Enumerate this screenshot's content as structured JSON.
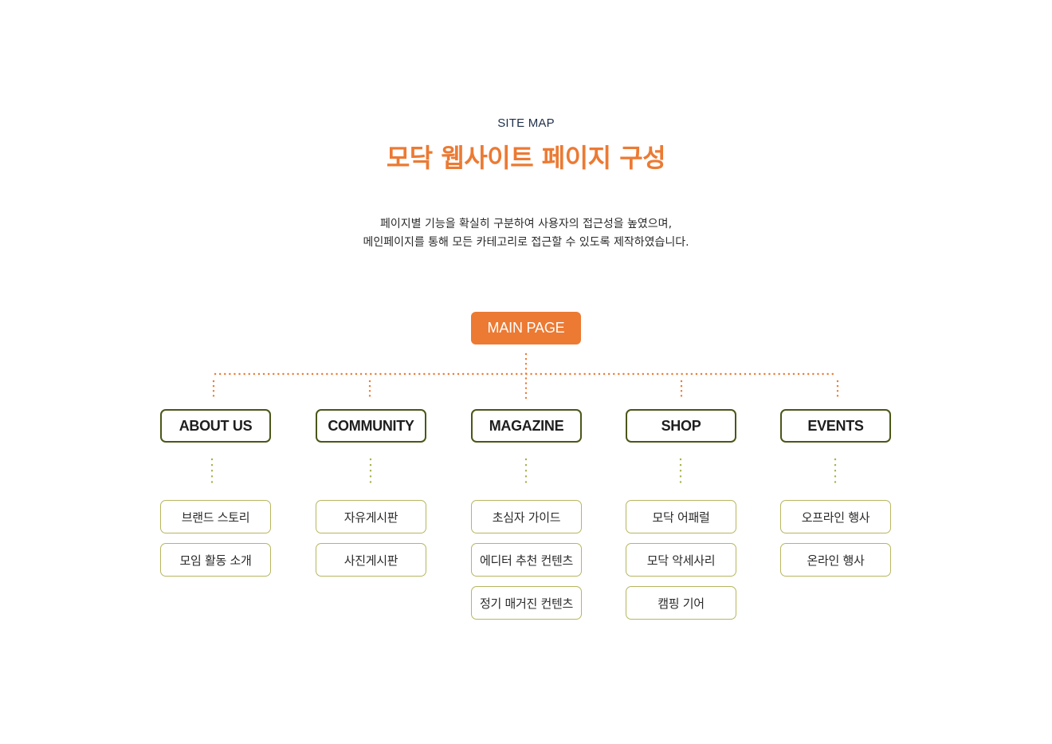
{
  "header": {
    "eyebrow": "SITE MAP",
    "title": "모닥 웹사이트 페이지 구성",
    "description_lines": [
      "페이지별 기능을 확실히 구분하여 사용자의 접근성을 높였으며,",
      "메인페이지를 통해 모든 카테고리로 접근할 수 있도록 제작하였습니다."
    ]
  },
  "colors": {
    "accent": "#ec7a33",
    "category_border": "#4a5719",
    "subpage_border": "#b7b65e",
    "sub_connector": "#a8b04a"
  },
  "sitemap": {
    "root": "MAIN PAGE",
    "categories": [
      {
        "label": "ABOUT US",
        "pages": [
          "브랜드 스토리",
          "모임 활동 소개"
        ]
      },
      {
        "label": "COMMUNITY",
        "pages": [
          "자유게시판",
          "사진게시판"
        ]
      },
      {
        "label": "MAGAZINE",
        "pages": [
          "초심자 가이드",
          "에디터 추천 컨텐츠",
          "정기 매거진 컨텐츠"
        ]
      },
      {
        "label": "SHOP",
        "pages": [
          "모닥 어패럴",
          "모닥 악세사리",
          "캠핑 기어"
        ]
      },
      {
        "label": "EVENTS",
        "pages": [
          "오프라인 행사",
          "온라인 행사"
        ]
      }
    ]
  }
}
